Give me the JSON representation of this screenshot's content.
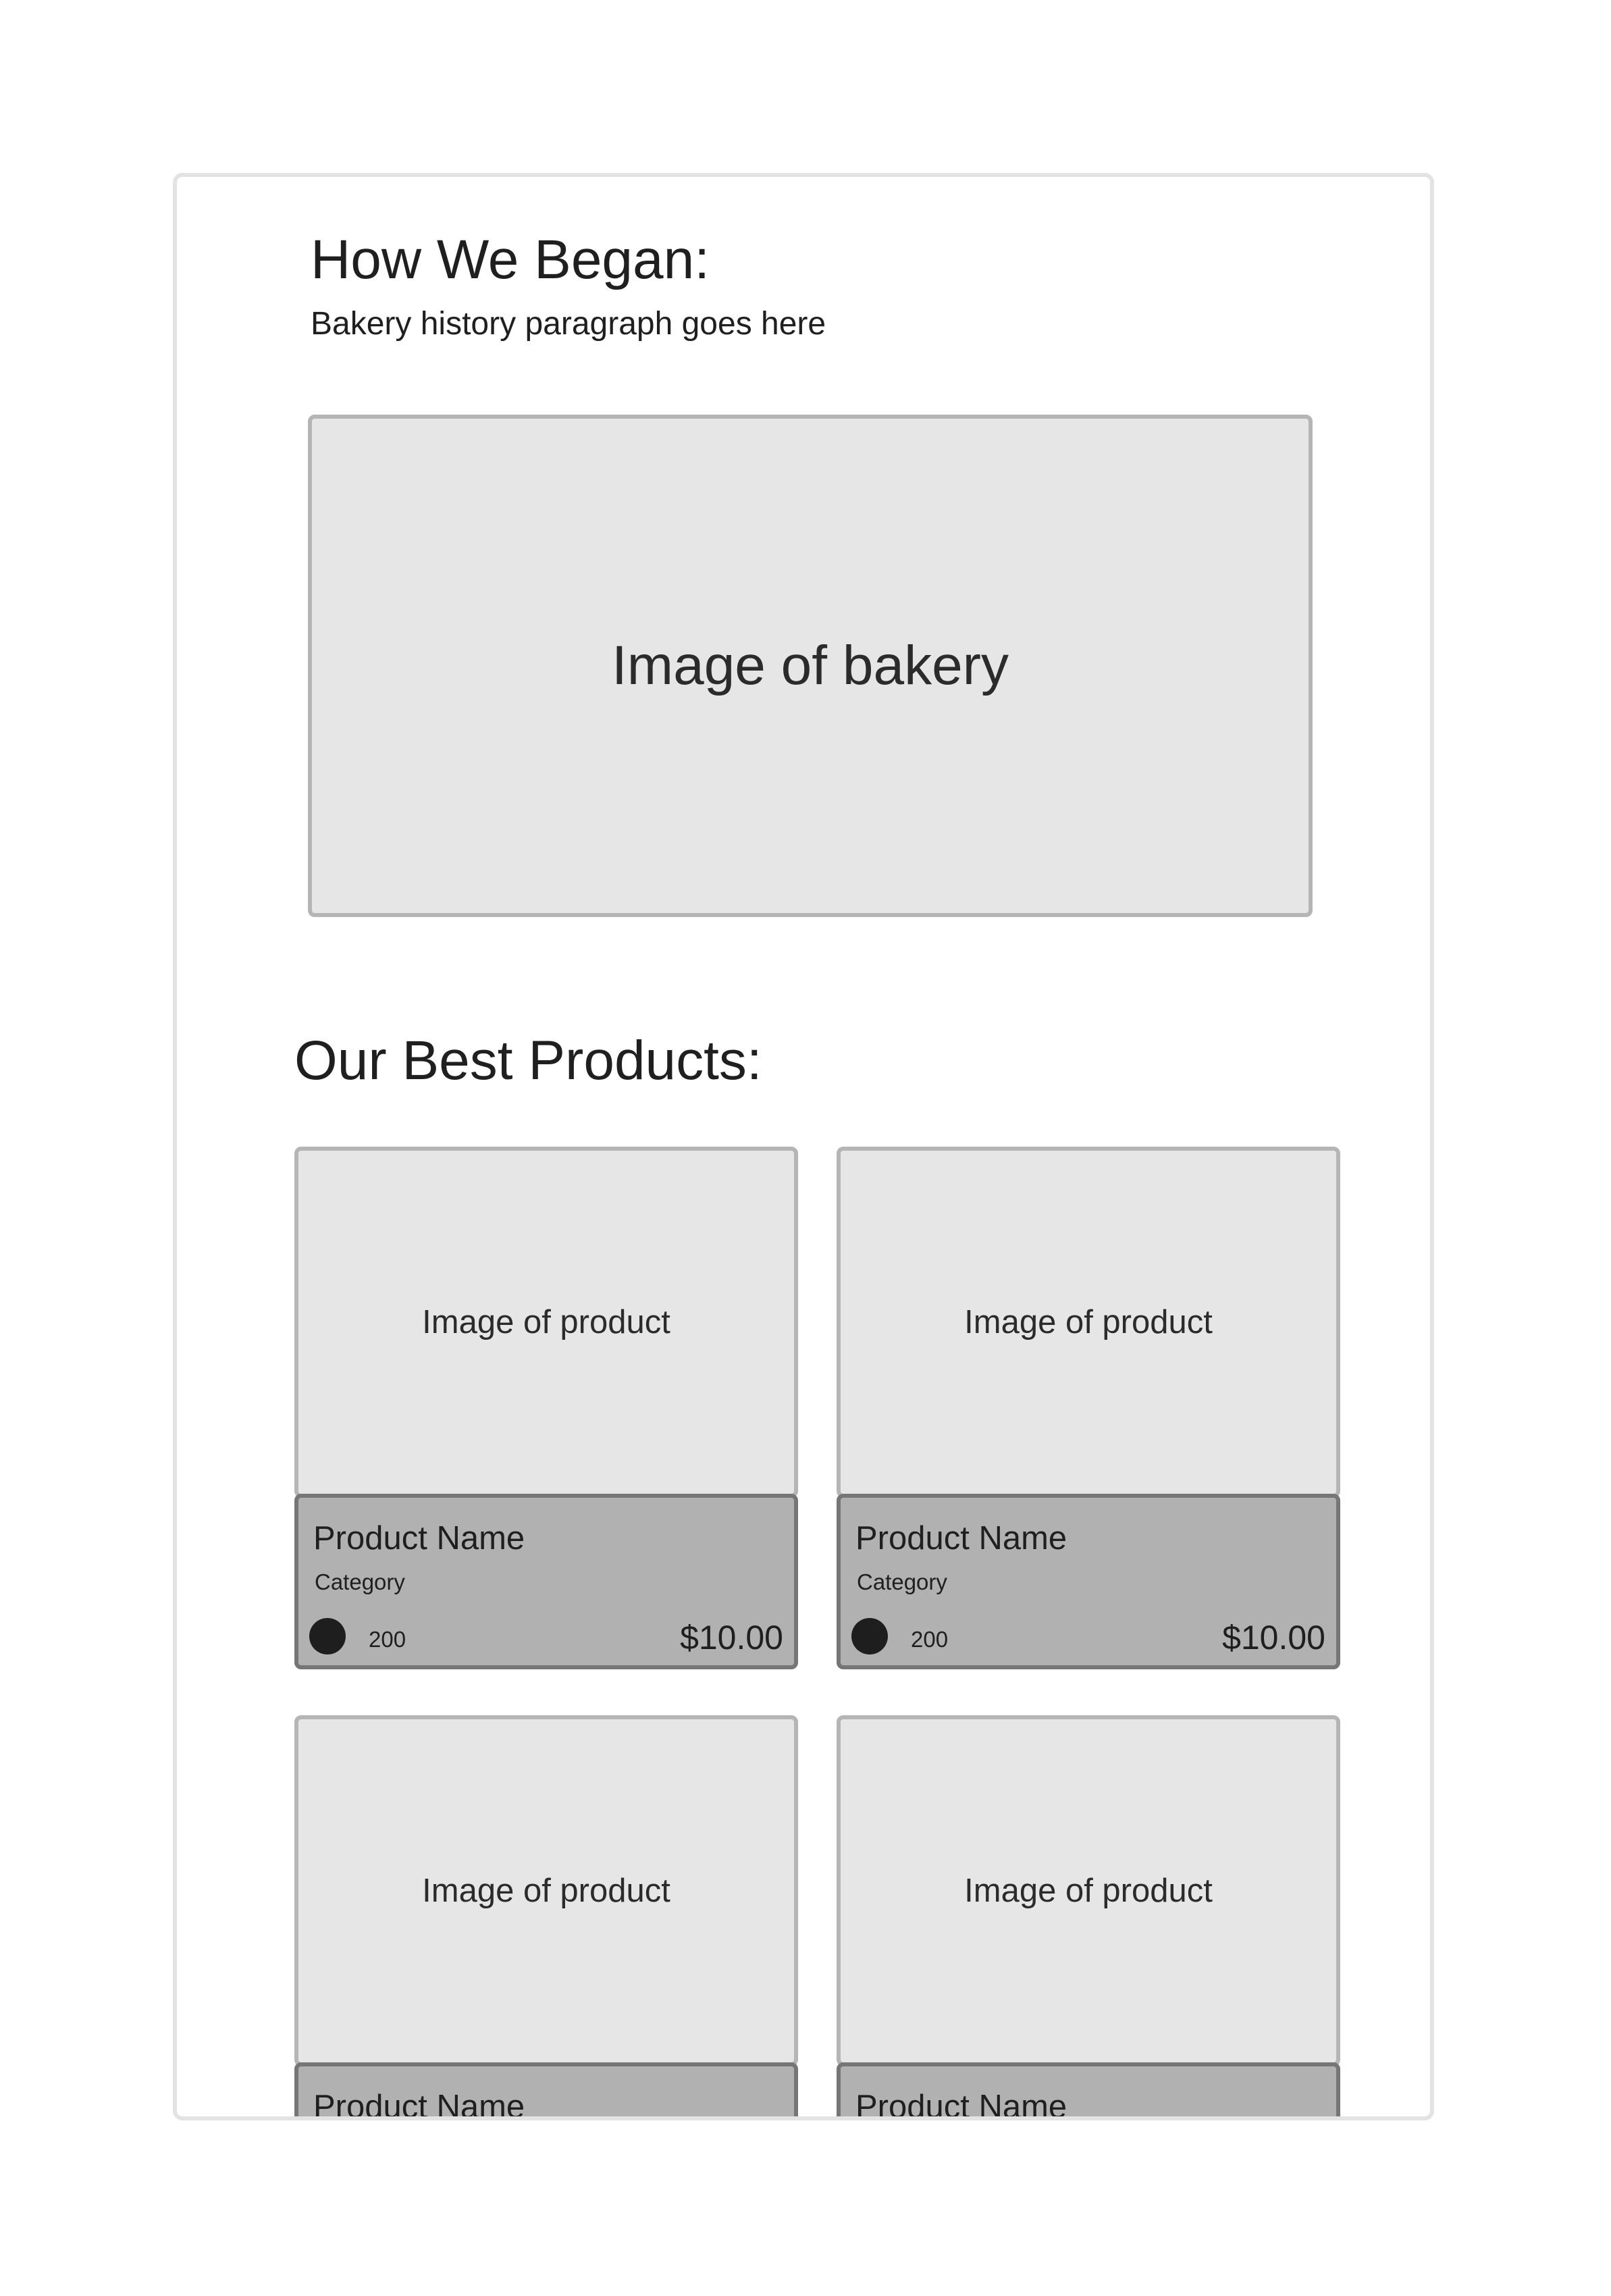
{
  "about": {
    "title": "How We Began:",
    "text": "Bakery history paragraph goes here",
    "image_label": "Image of bakery"
  },
  "products": {
    "title": "Our Best Products:",
    "items": [
      {
        "image_label": "Image of product",
        "name": "Product Name",
        "category": "Category",
        "rating_count": "200",
        "price": "$10.00"
      },
      {
        "image_label": "Image of product",
        "name": "Product Name",
        "category": "Category",
        "rating_count": "200",
        "price": "$10.00"
      },
      {
        "image_label": "Image of product",
        "name": "Product Name"
      },
      {
        "image_label": "Image of product",
        "name": "Product Name"
      }
    ]
  },
  "colors": {
    "placeholder_fill": "#e6e6e6",
    "placeholder_border": "#b5b5b5",
    "info_fill": "#b1b1b1",
    "info_border": "#767676",
    "text": "#1f1f1f"
  }
}
